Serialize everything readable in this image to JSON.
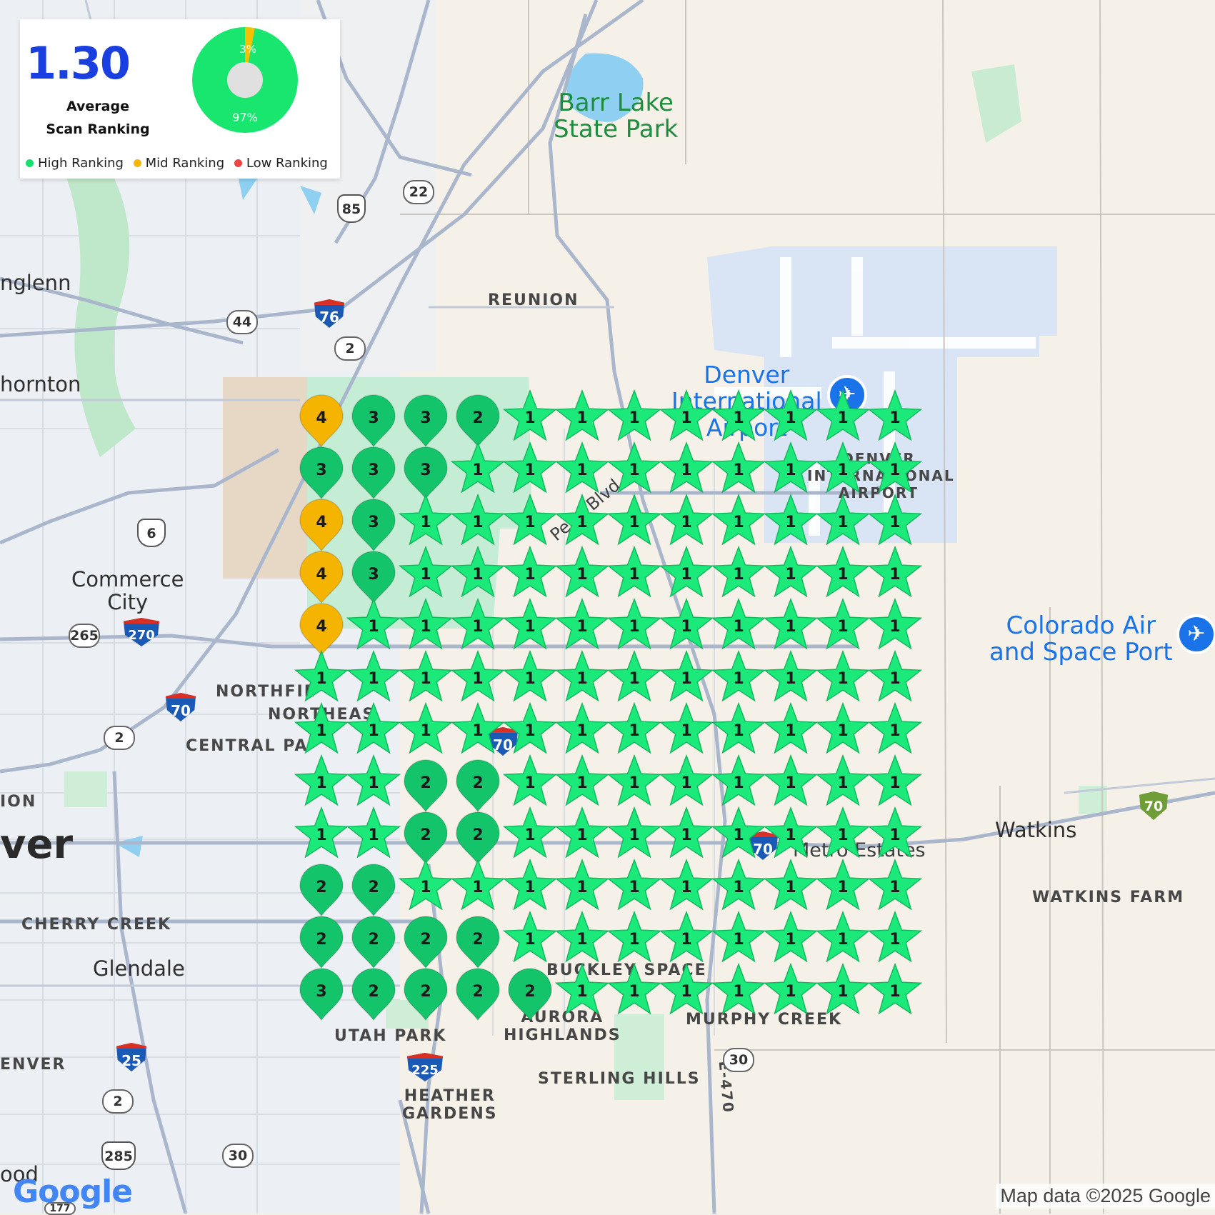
{
  "summary": {
    "average_value": "1.30",
    "average_label_line1": "Average",
    "average_label_line2": "Scan Ranking",
    "donut": {
      "high_pct": 97,
      "mid_pct": 3,
      "high_label": "97%",
      "mid_label": "3%"
    },
    "legend": [
      {
        "label": "High Ranking",
        "color": "#18e06f"
      },
      {
        "label": "Mid Ranking",
        "color": "#f5b800"
      },
      {
        "label": "Low Ranking",
        "color": "#ea4444"
      }
    ]
  },
  "colors": {
    "star": "#1bea7b",
    "high_pin": "#14c46a",
    "mid_pin": "#f5b400",
    "low_pin": "#ea4444"
  },
  "grid": [
    [
      "4",
      "3",
      "3",
      "2",
      "1",
      "1",
      "1",
      "1",
      "1",
      "1",
      "1",
      "1"
    ],
    [
      "3",
      "3",
      "3",
      "1",
      "1",
      "1",
      "1",
      "1",
      "1",
      "1",
      "1",
      "1"
    ],
    [
      "4",
      "3",
      "1",
      "1",
      "1",
      "1",
      "1",
      "1",
      "1",
      "1",
      "1",
      "1"
    ],
    [
      "4",
      "3",
      "1",
      "1",
      "1",
      "1",
      "1",
      "1",
      "1",
      "1",
      "1",
      "1"
    ],
    [
      "4",
      "1",
      "1",
      "1",
      "1",
      "1",
      "1",
      "1",
      "1",
      "1",
      "1",
      "1"
    ],
    [
      "1",
      "1",
      "1",
      "1",
      "1",
      "1",
      "1",
      "1",
      "1",
      "1",
      "1",
      "1"
    ],
    [
      "1",
      "1",
      "1",
      "1",
      "1",
      "1",
      "1",
      "1",
      "1",
      "1",
      "1",
      "1"
    ],
    [
      "1",
      "1",
      "2",
      "2",
      "1",
      "1",
      "1",
      "1",
      "1",
      "1",
      "1",
      "1"
    ],
    [
      "1",
      "1",
      "2",
      "2",
      "1",
      "1",
      "1",
      "1",
      "1",
      "1",
      "1",
      "1"
    ],
    [
      "2",
      "2",
      "1",
      "1",
      "1",
      "1",
      "1",
      "1",
      "1",
      "1",
      "1",
      "1"
    ],
    [
      "2",
      "2",
      "2",
      "2",
      "1",
      "1",
      "1",
      "1",
      "1",
      "1",
      "1",
      "1"
    ],
    [
      "3",
      "2",
      "2",
      "2",
      "2",
      "1",
      "1",
      "1",
      "1",
      "1",
      "1",
      "1"
    ]
  ],
  "places": {
    "barr_lake_1": "Barr Lake",
    "barr_lake_2": "State Park",
    "reunion": "REUNION",
    "northglenn": "nglenn",
    "thornton": "hornton",
    "commerce_city_1": "Commerce",
    "commerce_city_2": "City",
    "northfield": "NORTHFIE",
    "northeast": "NORTHEAS",
    "central_park": "CENTRAL PA",
    "denver": "ver",
    "cherry_creek": "CHERRY CREEK",
    "glendale": "Glendale",
    "denver_s": "ENVER",
    "ion": "ION",
    "utah_park": "UTAH PARK",
    "aurora_highlands_1": "AURORA",
    "aurora_highlands_2": "HIGHLANDS",
    "heather_gardens_1": "HEATHER",
    "heather_gardens_2": "GARDENS",
    "sterling_hills": "STERLING HILLS",
    "murphy_creek": "MURPHY CREEK",
    "buckley": "BUCKLEY SPACE",
    "denver_airport_1": "Denver",
    "denver_airport_2": "International",
    "denver_airport_3": "Airport",
    "dia_caps": "DENVER INTERNATIONAL AIRPORT",
    "colorado_air_1": "Colorado Air",
    "colorado_air_2": "and Space Port",
    "watkins": "Watkins",
    "watkins_farm": "WATKINS FARM",
    "wood": "ood",
    "e470": "E-470",
    "pena_blvd": "Pena Blvd",
    "metro_estates": "Metro Estates"
  },
  "shields": {
    "r22": "22",
    "r85": "85",
    "r44": "44",
    "r76": "76",
    "r2a": "2",
    "r6": "6",
    "r265": "265",
    "r270": "270",
    "r70a": "70",
    "r2b": "2",
    "r70b": "70",
    "r70c": "70",
    "r70d": "70",
    "r25": "25",
    "r225": "225",
    "r2c": "2",
    "r285": "285",
    "r30a": "30",
    "r30b": "30",
    "r177": "177"
  },
  "footer": {
    "logo": "Google",
    "attribution": "Map data ©2025 Google"
  }
}
